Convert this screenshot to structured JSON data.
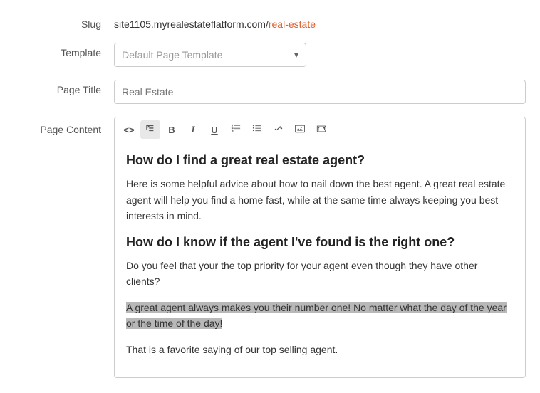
{
  "slug": {
    "label": "Slug",
    "base": "site1105.myrealestateflatform.com/",
    "display_base": "site1105.myrealestateflatform.com/",
    "full": "site1105.myrealestateflatform.com/real-estate",
    "base_text": "site1105.myrealestateflatform.com/",
    "link_text": "real-estate"
  },
  "template": {
    "label": "Template",
    "value": "Default Page Template",
    "placeholder": "Default Page Template"
  },
  "page_title": {
    "label": "Page Title",
    "value": "",
    "placeholder": "Real Estate"
  },
  "page_content": {
    "label": "Page Content",
    "toolbar": {
      "code": "<>",
      "format": "¶",
      "bold": "B",
      "italic": "I",
      "underline": "U",
      "list_ordered": "ol",
      "list_unordered": "ul",
      "link": "link",
      "image": "img",
      "embed": "embed"
    },
    "content": {
      "h2_1": "How do I find a great real estate agent?",
      "p1": "Here is some helpful advice about how to nail down the best agent. A great real estate agent will help you find a home fast, while at the same time always keeping you best interests in mind.",
      "h2_2": "How do I know if the agent I've found is the right one?",
      "p2": "Do you feel that your the top priority for your agent even though they have other clients?",
      "p3_highlighted": "A great agent always makes you their number one! No matter what the day of the year or the time of the day!",
      "p4": "That is a favorite saying of our top selling agent."
    }
  }
}
